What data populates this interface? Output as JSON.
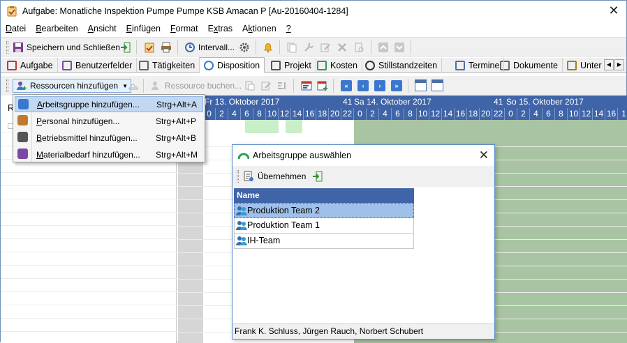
{
  "window": {
    "title": "Aufgabe: Monatliche Inspektion Pumpe Pumpe KSB Amacan P [Au-20160404-1284]",
    "close_glyph": "✕"
  },
  "menu": [
    {
      "label": "Datei",
      "accel": "D"
    },
    {
      "label": "Bearbeiten",
      "accel": "B"
    },
    {
      "label": "Ansicht",
      "accel": "A"
    },
    {
      "label": "Einfügen",
      "accel": "E"
    },
    {
      "label": "Format",
      "accel": "F"
    },
    {
      "label": "Extras",
      "accel": "x"
    },
    {
      "label": "Aktionen",
      "accel": "k"
    },
    {
      "label": "?",
      "accel": "?"
    }
  ],
  "toolbar": {
    "save_close_label": "Speichern und Schließen",
    "interval_label": "Intervall..."
  },
  "tabs": [
    {
      "label": "Aufgabe",
      "icon": "task-icon",
      "active": false
    },
    {
      "label": "Benutzerfelder",
      "icon": "users-icon",
      "active": false
    },
    {
      "label": "Tätigkeiten",
      "icon": "wrench-icon",
      "active": false
    },
    {
      "label": "Disposition",
      "icon": "people-icon",
      "active": true
    },
    {
      "label": "Projekt",
      "icon": "project-icon",
      "active": false
    },
    {
      "label": "Kosten",
      "icon": "money-icon",
      "active": false
    },
    {
      "label": "Stillstandzeiten",
      "icon": "clock-icon",
      "active": false
    },
    {
      "label": "Termine",
      "icon": "calendar-icon",
      "active": false
    },
    {
      "label": "Dokumente",
      "icon": "document-icon",
      "active": false
    },
    {
      "label": "Unter",
      "icon": "subtask-icon",
      "active": false
    }
  ],
  "toolbar2": {
    "add_resources_label": "Ressourcen hinzufügen",
    "book_resource_label": "Ressource buchen..."
  },
  "left_pane": {
    "header_letter": "R"
  },
  "gantt": {
    "days": [
      {
        "label": "Fr 13. Oktober 2017",
        "week": "41"
      },
      {
        "label": "Sa 14. Oktober 2017",
        "week": "41"
      },
      {
        "label": "So 15. Oktober 2017",
        "week": ""
      }
    ],
    "hours_day1": [
      "0",
      "2",
      "4",
      "6",
      "8",
      "10",
      "12",
      "14",
      "16",
      "18",
      "20",
      "22"
    ],
    "hours_day2": [
      "0",
      "2",
      "4",
      "6",
      "8",
      "10",
      "12",
      "14",
      "16",
      "18",
      "20",
      "22"
    ],
    "hours_day3": [
      "0",
      "2",
      "4",
      "6",
      "8",
      "10",
      "12",
      "14",
      "16",
      "1"
    ]
  },
  "popup_menu": [
    {
      "label": "Arbeitsgruppe hinzufügen...",
      "accel": "A",
      "shortcut": "Strg+Alt+A",
      "icon": "workgroup-icon",
      "selected": true
    },
    {
      "label": "Personal hinzufügen...",
      "accel": "P",
      "shortcut": "Strg+Alt+P",
      "icon": "person-icon",
      "selected": false
    },
    {
      "label": "Betriebsmittel hinzufügen...",
      "accel": "B",
      "shortcut": "Strg+Alt+B",
      "icon": "equipment-icon",
      "selected": false
    },
    {
      "label": "Materialbedarf hinzufügen...",
      "accel": "M",
      "shortcut": "Strg+Alt+M",
      "icon": "material-icon",
      "selected": false
    }
  ],
  "dialog": {
    "title": "Arbeitsgruppe auswählen",
    "close_glyph": "✕",
    "apply_label": "Übernehmen",
    "column_header": "Name",
    "rows": [
      {
        "name": "Produktion Team 2",
        "selected": true
      },
      {
        "name": "Produktion Team 1",
        "selected": false
      },
      {
        "name": "IH-Team",
        "selected": false
      }
    ],
    "status": "Frank K. Schluss, Jürgen Rauch, Norbert Schubert"
  },
  "colors": {
    "header_blue": "#3f64a8",
    "weekend_green": "#a9c4a2",
    "selection_blue": "#9fc0e8"
  }
}
